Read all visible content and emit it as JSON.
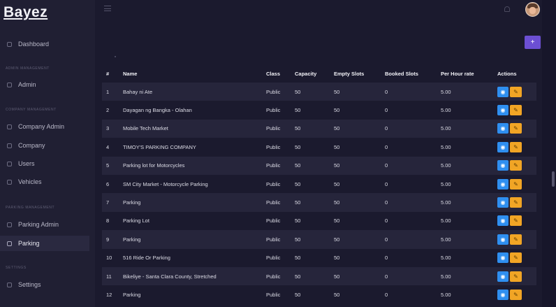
{
  "brand": "Bayez",
  "sidebar": {
    "items": [
      {
        "label": "Dashboard",
        "icon": "dashboard-icon",
        "active": false
      },
      {
        "heading": "Admin Management"
      },
      {
        "label": "Admin",
        "icon": "admin-icon",
        "active": false
      },
      {
        "heading": "Company Management"
      },
      {
        "label": "Company Admin",
        "icon": "company-admin-icon",
        "active": false
      },
      {
        "label": "Company",
        "icon": "company-icon",
        "active": false
      },
      {
        "label": "Users",
        "icon": "users-icon",
        "active": false
      },
      {
        "label": "Vehicles",
        "icon": "vehicles-icon",
        "active": false
      },
      {
        "heading": "Parking Management"
      },
      {
        "label": "Parking Admin",
        "icon": "parking-admin-icon",
        "active": false
      },
      {
        "label": "Parking",
        "icon": "parking-icon",
        "active": true
      },
      {
        "heading": "Settings"
      },
      {
        "label": "Settings",
        "icon": "settings-icon",
        "active": false
      }
    ]
  },
  "topbar": {
    "menu_icon": "hamburger-icon",
    "notification_icon": "bell-icon",
    "avatar": "user-avatar"
  },
  "toolbar": {
    "add_label": "+"
  },
  "table": {
    "columns": [
      "#",
      "Name",
      "Class",
      "Capacity",
      "Empty Slots",
      "Booked Slots",
      "Per Hour rate",
      "Actions"
    ],
    "rows": [
      {
        "num": "1",
        "name": "Bahay ni Ate",
        "class": "Public",
        "capacity": "50",
        "empty": "50",
        "booked": "0",
        "rate": "5.00"
      },
      {
        "num": "2",
        "name": "Dayagan ng Bangka - Olahan",
        "class": "Public",
        "capacity": "50",
        "empty": "50",
        "booked": "0",
        "rate": "5.00"
      },
      {
        "num": "3",
        "name": "Mobile Tech Market",
        "class": "Public",
        "capacity": "50",
        "empty": "50",
        "booked": "0",
        "rate": "5.00"
      },
      {
        "num": "4",
        "name": "TIMOY'S PARKING COMPANY",
        "class": "Public",
        "capacity": "50",
        "empty": "50",
        "booked": "0",
        "rate": "5.00"
      },
      {
        "num": "5",
        "name": "Parking lot for Motorcycles",
        "class": "Public",
        "capacity": "50",
        "empty": "50",
        "booked": "0",
        "rate": "5.00"
      },
      {
        "num": "6",
        "name": "SM City Market - Motorcycle Parking",
        "class": "Public",
        "capacity": "50",
        "empty": "50",
        "booked": "0",
        "rate": "5.00"
      },
      {
        "num": "7",
        "name": "Parking",
        "class": "Public",
        "capacity": "50",
        "empty": "50",
        "booked": "0",
        "rate": "5.00"
      },
      {
        "num": "8",
        "name": "Parking Lot",
        "class": "Public",
        "capacity": "50",
        "empty": "50",
        "booked": "0",
        "rate": "5.00"
      },
      {
        "num": "9",
        "name": "Parking",
        "class": "Public",
        "capacity": "50",
        "empty": "50",
        "booked": "0",
        "rate": "5.00"
      },
      {
        "num": "10",
        "name": "516 Ride Or Parking",
        "class": "Public",
        "capacity": "50",
        "empty": "50",
        "booked": "0",
        "rate": "5.00"
      },
      {
        "num": "11",
        "name": "Bikeliye - Santa Clara County, Stretched",
        "class": "Public",
        "capacity": "50",
        "empty": "50",
        "booked": "0",
        "rate": "5.00"
      },
      {
        "num": "12",
        "name": "Parking",
        "class": "Public",
        "capacity": "50",
        "empty": "50",
        "booked": "0",
        "rate": "5.00"
      }
    ],
    "view_icon": "eye-icon",
    "edit_icon": "pencil-icon",
    "view_glyph": "◉",
    "edit_glyph": "✎"
  },
  "colors": {
    "background": "#1b1a2e",
    "sidebar": "#201f33",
    "accent": "#6c4fd3",
    "view_button": "#2f8ff0",
    "edit_button": "#f1a525"
  }
}
